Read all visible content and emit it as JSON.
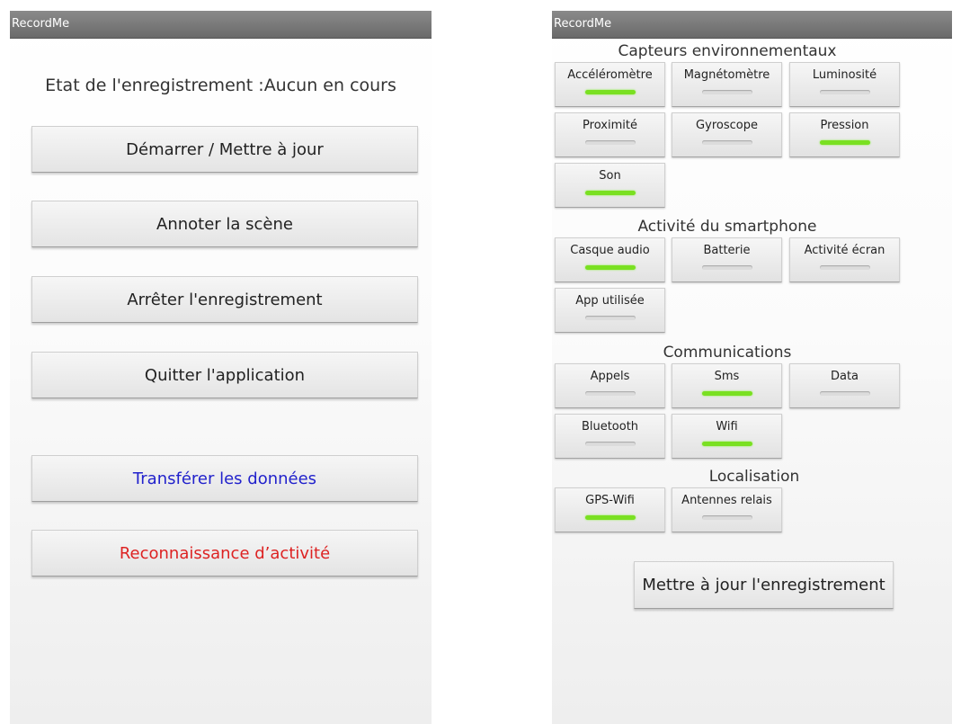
{
  "app_title": "RecordMe",
  "left": {
    "status_text": "Etat de l'enregistrement :Aucun en cours",
    "buttons": [
      {
        "label": "Démarrer / Mettre à jour",
        "color": "#222222"
      },
      {
        "label": "Annoter la scène",
        "color": "#222222"
      },
      {
        "label": "Arrêter l'enregistrement",
        "color": "#222222"
      },
      {
        "label": "Quitter l'application",
        "color": "#222222"
      },
      {
        "label": "Transférer les données",
        "color": "#2222cc"
      },
      {
        "label": "Reconnaissance d’activité",
        "color": "#dd2222"
      }
    ]
  },
  "right": {
    "sections": [
      {
        "title": "Capteurs environnementaux",
        "toggles": [
          {
            "label": "Accéléromètre",
            "on": true
          },
          {
            "label": "Magnétomètre",
            "on": false
          },
          {
            "label": "Luminosité",
            "on": false
          },
          {
            "label": "Proximité",
            "on": false
          },
          {
            "label": "Gyroscope",
            "on": false
          },
          {
            "label": "Pression",
            "on": true
          },
          {
            "label": "Son",
            "on": true
          }
        ]
      },
      {
        "title": "Activité du smartphone",
        "toggles": [
          {
            "label": "Casque audio",
            "on": true
          },
          {
            "label": "Batterie",
            "on": false
          },
          {
            "label": "Activité écran",
            "on": false
          },
          {
            "label": "App utilisée",
            "on": false
          }
        ]
      },
      {
        "title": "Communications",
        "toggles": [
          {
            "label": "Appels",
            "on": false
          },
          {
            "label": "Sms",
            "on": true
          },
          {
            "label": "Data",
            "on": false
          },
          {
            "label": "Bluetooth",
            "on": false
          },
          {
            "label": "Wifi",
            "on": true
          }
        ]
      },
      {
        "title": "Localisation",
        "toggles": [
          {
            "label": "GPS-Wifi",
            "on": true
          },
          {
            "label": "Antennes relais",
            "on": false
          }
        ]
      }
    ],
    "update_button": "Mettre à jour l'enregistrement"
  },
  "colors": {
    "toggle_on": "#7ae022",
    "toggle_off": "#dcdcdc",
    "title_bar": "#7a7a7a"
  }
}
